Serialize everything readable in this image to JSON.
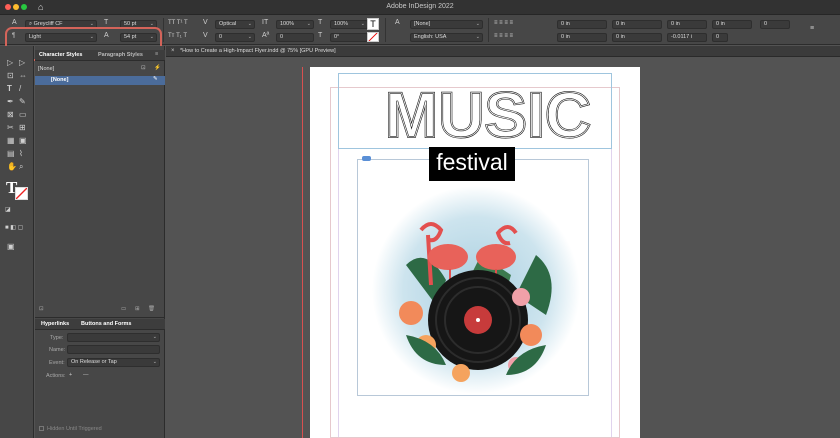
{
  "window": {
    "title": "Adobe InDesign 2022"
  },
  "control_panel": {
    "font_family": "Greycliff CF",
    "font_style": "Light",
    "font_size": "50 pt",
    "leading": "54 pt",
    "vertical_scale": "100%",
    "horizontal_scale": "100%",
    "kerning": "Optical",
    "tracking": "0",
    "baseline_shift": "0",
    "skew": "0°",
    "character_style": "[None]",
    "language": "English: USA",
    "indent_left": "0 in",
    "indent_first": "0 in",
    "indent_right": "0 in",
    "space_last": "0 in",
    "space_before": "0 in",
    "space_after": "0 in",
    "drop_cap_lines": "0",
    "drop_cap_chars": "0",
    "grid_align": "-0.0117 i"
  },
  "document": {
    "tab_title": "*How to Create a High-Impact Flyer.indd @ 75% [GPU Preview]",
    "headline": "MUSIC",
    "subhead": "festival"
  },
  "panels": {
    "styles_tabs": [
      "Character Styles",
      "Paragraph Styles"
    ],
    "current_style": "[None]",
    "style_items": [
      "[None]"
    ],
    "bottom_tabs": [
      "Hyperlinks",
      "Buttons and Forms"
    ],
    "type_label": "Type:",
    "name_label": "Name:",
    "event_label": "Event:",
    "event_value": "On Release or Tap",
    "actions_label": "Actions:",
    "hidden_label": "Hidden Until Triggered"
  },
  "colors": {
    "accent": "#d4645a",
    "selection": "#4b6c9b"
  }
}
